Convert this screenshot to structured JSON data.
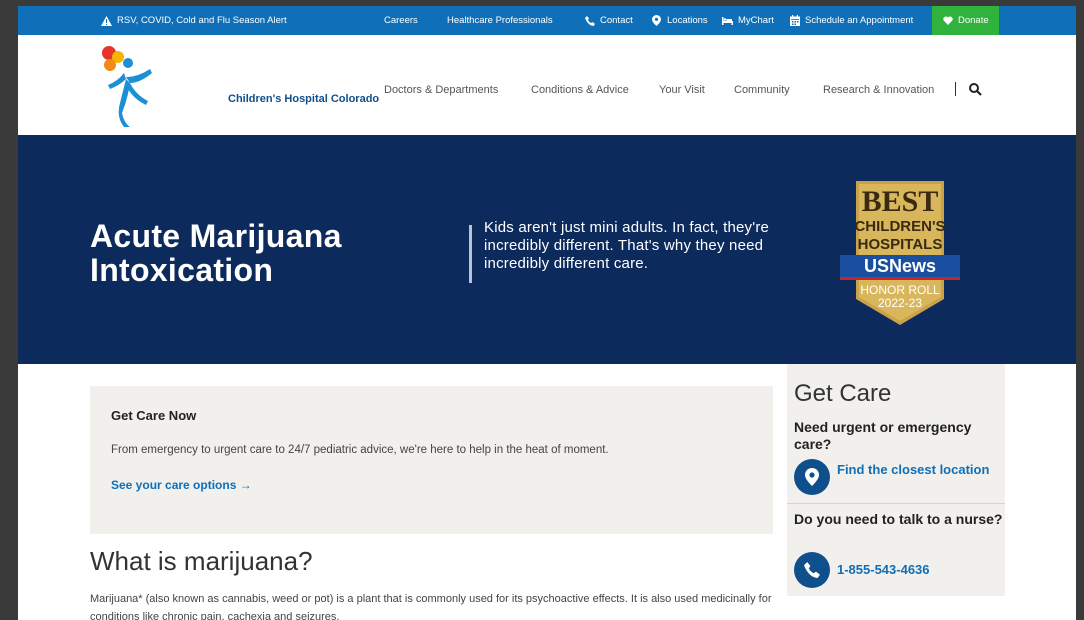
{
  "utility_bar": {
    "alert": "RSV, COVID, Cold and Flu Season Alert",
    "careers": "Careers",
    "healthcare_professionals": "Healthcare Professionals",
    "contact": "Contact",
    "locations": "Locations",
    "mychart": "MyChart",
    "schedule": "Schedule an Appointment",
    "donate": "Donate"
  },
  "header": {
    "logo_text": "Children's Hospital Colorado",
    "nav": [
      "Doctors & Departments",
      "Conditions & Advice",
      "Your Visit",
      "Community",
      "Research & Innovation"
    ],
    "search_icon": "search-icon"
  },
  "hero": {
    "title": "Acute Marijuana Intoxication",
    "quote": "Kids aren't just mini adults. In fact, they're incredibly different. That's why they need incredibly different care.",
    "badge": {
      "line1": "BEST",
      "line2": "CHILDREN'S",
      "line3": "HOSPITALS",
      "brand": "USNews",
      "line4": "HONOR ROLL",
      "line5": "2022-23"
    }
  },
  "care_card": {
    "title": "Get Care Now",
    "description": "From emergency to urgent care to 24/7 pediatric advice, we're here to help in the heat of moment.",
    "link": "See your care options →"
  },
  "main": {
    "heading": "What is marijuana?",
    "paragraph": "Marijuana* (also known as cannabis, weed or pot) is a plant that is commonly used for its psychoactive effects. It is also used medicinally for conditions like chronic pain, cachexia and seizures."
  },
  "sidebar": {
    "heading": "Get Care",
    "question1": "Need urgent or emergency care?",
    "link1": "Find the closest location",
    "question2": "Do you need to talk to a nurse?",
    "phone": "1-855-543-4636"
  },
  "colors": {
    "utility_blue": "#0f6fb8",
    "hero_navy": "#0c2a5c",
    "donate_green": "#2fb33d",
    "card_bg": "#f1f0ec"
  }
}
